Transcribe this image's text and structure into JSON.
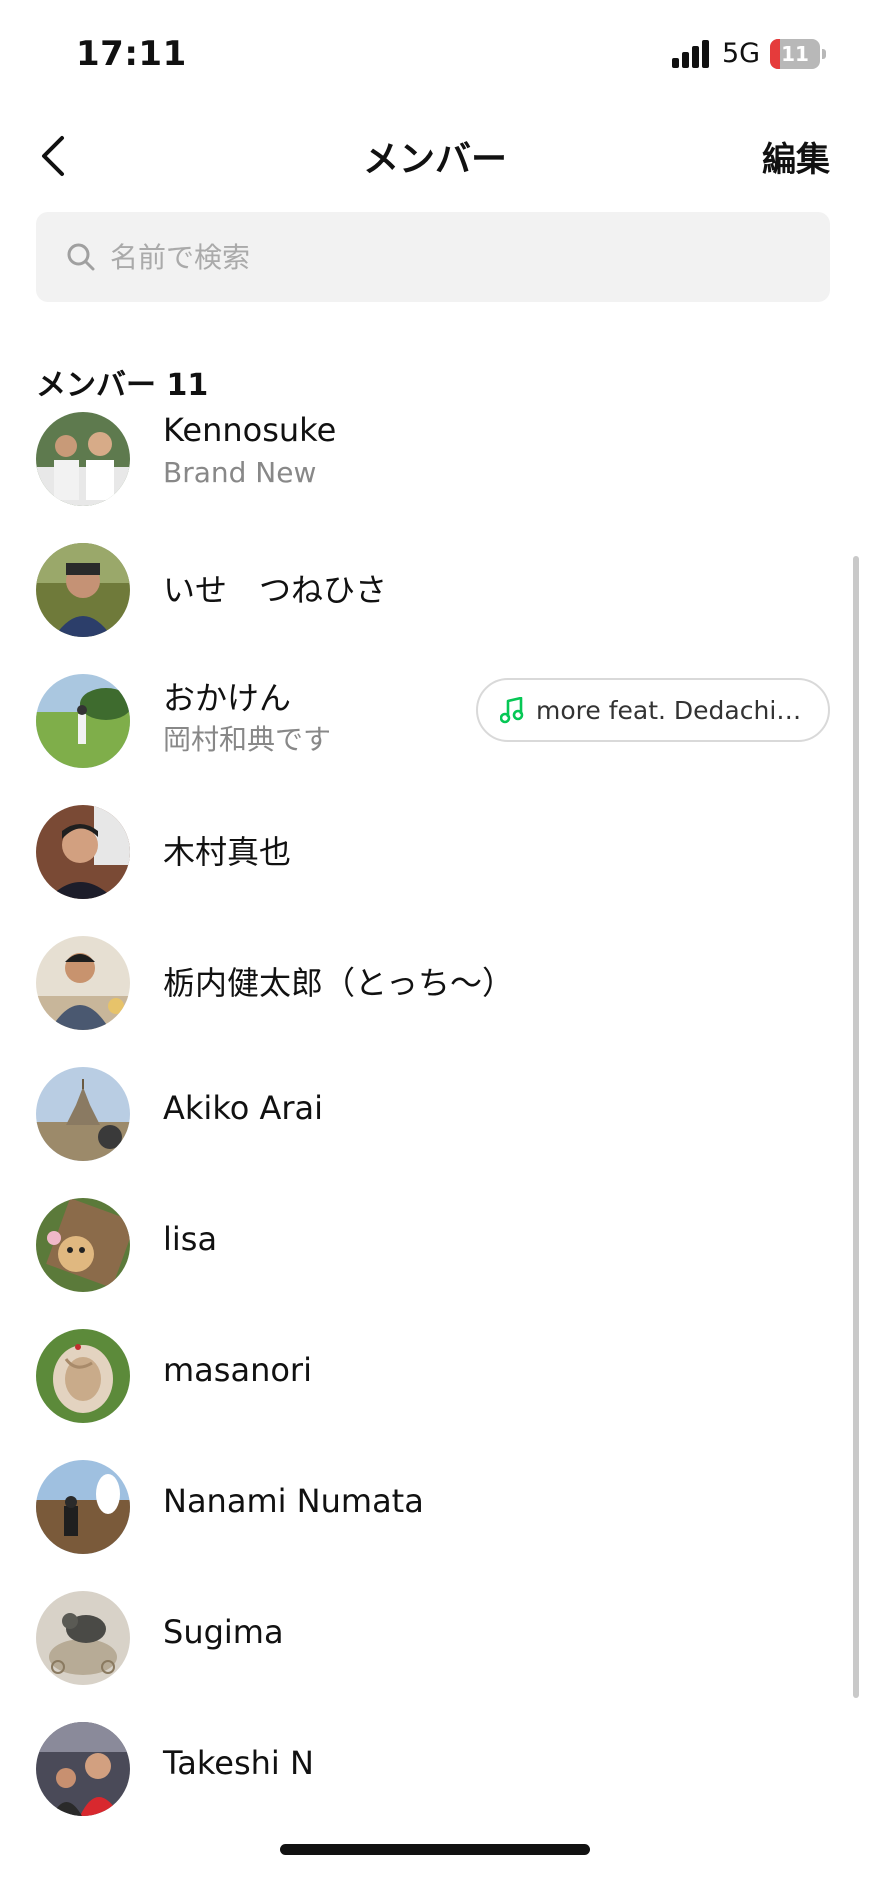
{
  "status_bar": {
    "time": "17:11",
    "network": "5G",
    "battery": "11"
  },
  "header": {
    "title": "メンバー",
    "edit_label": "編集"
  },
  "search": {
    "placeholder": "名前で検索"
  },
  "section": {
    "label": "メンバー 11"
  },
  "members": [
    {
      "name": "Kennosuke",
      "status": "Brand New"
    },
    {
      "name": "いせ　つねひさ"
    },
    {
      "name": "おかけん",
      "status": "岡村和典です",
      "music": "more feat. DedachiKe..."
    },
    {
      "name": "木村真也"
    },
    {
      "name": "栃内健太郎（とっち〜）"
    },
    {
      "name": "Akiko Arai"
    },
    {
      "name": "lisa"
    },
    {
      "name": "masanori"
    },
    {
      "name": "Nanami  Numata"
    },
    {
      "name": "Sugima"
    },
    {
      "name": "Takeshi N"
    }
  ],
  "colors": {
    "accent_green": "#06c755",
    "battery_low": "#e53b3b",
    "search_bg": "#f2f2f2",
    "secondary_text": "#888888"
  },
  "icons": {
    "back": "chevron-left-icon",
    "search": "search-icon",
    "music": "music-note-icon"
  }
}
